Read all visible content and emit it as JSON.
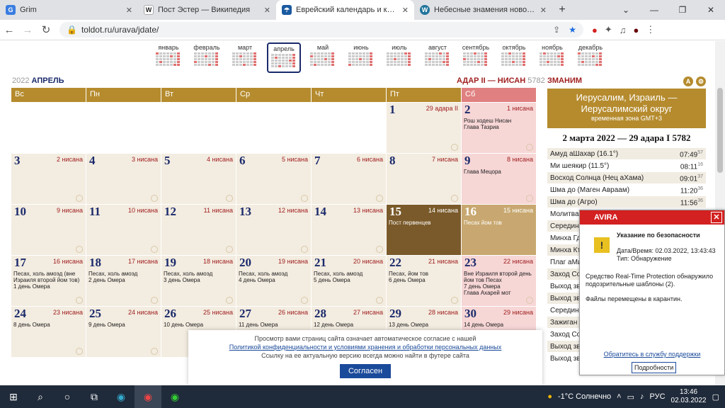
{
  "browser": {
    "tabs": [
      {
        "title": "Grim",
        "icon": "grim-icon",
        "color": "#3b7de0"
      },
      {
        "title": "Пост Эстер — Википедия",
        "icon": "wikipedia-icon",
        "color": "#222222"
      },
      {
        "title": "Еврейский календарь и конвер",
        "icon": "toldot-icon",
        "color": "#1a5aa0",
        "active": true
      },
      {
        "title": "Небесные знамения новой вой",
        "icon": "wordpress-icon",
        "color": "#21759b"
      }
    ],
    "url": "toldot.ru/urava/jdate/"
  },
  "months": [
    {
      "name": "январь"
    },
    {
      "name": "февраль"
    },
    {
      "name": "март"
    },
    {
      "name": "апрель",
      "selected": true
    },
    {
      "name": "май"
    },
    {
      "name": "июнь"
    },
    {
      "name": "июль"
    },
    {
      "name": "август"
    },
    {
      "name": "сентябрь"
    },
    {
      "name": "октябрь"
    },
    {
      "name": "ноябрь"
    },
    {
      "name": "декабрь"
    }
  ],
  "calendar": {
    "year": "2022",
    "month": "АПРЕЛЬ",
    "hebrew_months": "АДАР II — НИСАН",
    "hebrew_year": "5782",
    "weekdays": [
      "Вс",
      "Пн",
      "Вт",
      "Ср",
      "Чт",
      "Пт",
      "Сб"
    ],
    "cells": [
      {
        "g": "",
        "h": "",
        "ev": ""
      },
      {
        "g": "",
        "h": "",
        "ev": ""
      },
      {
        "g": "",
        "h": "",
        "ev": ""
      },
      {
        "g": "",
        "h": "",
        "ev": ""
      },
      {
        "g": "",
        "h": "",
        "ev": ""
      },
      {
        "g": "1",
        "h": "29 адара II",
        "ev": ""
      },
      {
        "g": "2",
        "h": "1 нисана",
        "ev": "Рош ходеш Нисан",
        "ev2": "Глава Тазриа",
        "sat": true
      },
      {
        "g": "3",
        "h": "2 нисана",
        "ev": ""
      },
      {
        "g": "4",
        "h": "3 нисана",
        "ev": ""
      },
      {
        "g": "5",
        "h": "4 нисана",
        "ev": ""
      },
      {
        "g": "6",
        "h": "5 нисана",
        "ev": ""
      },
      {
        "g": "7",
        "h": "6 нисана",
        "ev": ""
      },
      {
        "g": "8",
        "h": "7 нисана",
        "ev": ""
      },
      {
        "g": "9",
        "h": "8 нисана",
        "ev": "Глава Мецора",
        "sat": true
      },
      {
        "g": "10",
        "h": "9 нисана",
        "ev": ""
      },
      {
        "g": "11",
        "h": "10 нисана",
        "ev": ""
      },
      {
        "g": "12",
        "h": "11 нисана",
        "ev": ""
      },
      {
        "g": "13",
        "h": "12 нисана",
        "ev": ""
      },
      {
        "g": "14",
        "h": "13 нисана",
        "ev": ""
      },
      {
        "g": "15",
        "h": "14 нисана",
        "ev": "Пост первенцев",
        "img": true
      },
      {
        "g": "16",
        "h": "15 нисана",
        "ev": "Песах йом тов",
        "img2": true
      },
      {
        "g": "17",
        "h": "16 нисана",
        "ev": "Песах, холь амоэд (вне Израиля второй йом тов)",
        "ev2": "1 день Омера"
      },
      {
        "g": "18",
        "h": "17 нисана",
        "ev": "Песах, холь амоэд",
        "ev2": "2 день Омера"
      },
      {
        "g": "19",
        "h": "18 нисана",
        "ev": "Песах, холь амоэд",
        "ev2": "3 день Омера"
      },
      {
        "g": "20",
        "h": "19 нисана",
        "ev": "Песах, холь амоэд",
        "ev2": "4 день Омера"
      },
      {
        "g": "21",
        "h": "20 нисана",
        "ev": "Песах, холь амоэд",
        "ev2": "5 день Омера"
      },
      {
        "g": "22",
        "h": "21 нисана",
        "ev": "Песах, йом тов",
        "ev2": "6 день Омера"
      },
      {
        "g": "23",
        "h": "22 нисана",
        "ev": "Вне Израиля второй день йом тов Песах",
        "ev2": "7 день Омера",
        "ev3": "Глава Ахарей мот",
        "sat": true
      },
      {
        "g": "24",
        "h": "23 нисана",
        "ev": "8 день Омера"
      },
      {
        "g": "25",
        "h": "24 нисана",
        "ev": "9 день Омера"
      },
      {
        "g": "26",
        "h": "25 нисана",
        "ev": "10 день Омера"
      },
      {
        "g": "27",
        "h": "26 нисана",
        "ev": "11 день Омера"
      },
      {
        "g": "28",
        "h": "27 нисана",
        "ev": "12 день Омера"
      },
      {
        "g": "29",
        "h": "28 нисана",
        "ev": "13 день Омера"
      },
      {
        "g": "30",
        "h": "29 нисана",
        "ev": "14 день Омера",
        "sat": true
      }
    ]
  },
  "sidebar": {
    "title": "ЗМАНИМ",
    "city": "Иерусалим, Израиль — Иерусалимский округ",
    "timezone": "временная зона GMT+3",
    "date": "2 марта 2022 — 29 адара I 5782",
    "zmanim": [
      {
        "name": "Амуд аШахар (16.1°)",
        "time": "07:49",
        "sec": "57"
      },
      {
        "name": "Ми шеякир (11.5°)",
        "time": "08:11",
        "sec": "16"
      },
      {
        "name": "Восход Солнца (Нец аХама)",
        "time": "09:01",
        "sec": "37"
      },
      {
        "name": "Шма до (Маген Авраам)",
        "time": "11:20",
        "sec": "36"
      },
      {
        "name": "Шма до (Агро)",
        "time": "11:56",
        "sec": "36"
      },
      {
        "name": "Молитва",
        "time": "",
        "sec": ""
      },
      {
        "name": "Середина",
        "time": "",
        "sec": ""
      },
      {
        "name": "Минха Гд",
        "time": "",
        "sec": ""
      },
      {
        "name": "Минха Кт",
        "time": "",
        "sec": ""
      },
      {
        "name": "Плаг аМи",
        "time": "",
        "sec": ""
      },
      {
        "name": "Заход Со",
        "time": "",
        "sec": ""
      },
      {
        "name": "Выход зв",
        "time": "",
        "sec": ""
      },
      {
        "name": "Выход зв",
        "time": "",
        "sec": ""
      },
      {
        "name": "Середина",
        "time": "",
        "sec": ""
      }
    ],
    "zmanim_lower": [
      {
        "name": "Зажиган"
      },
      {
        "name": "Заход Со"
      },
      {
        "name": "Выход зв"
      },
      {
        "name": "Выход зв"
      }
    ]
  },
  "cookie": {
    "line1": "Просмотр вами страниц сайта означает автоматическое согласие с нашей",
    "link": "Политикой конфиденциальности и условиями хранения и обработки персональных данных",
    "line2": "Ссылку на ее актуальную версию всегда можно найти в футере сайта",
    "button": "Согласен"
  },
  "avira": {
    "brand": "AVIRA",
    "title": "Указание по безопасности",
    "datetime": "Дата/Время: 02.03.2022, 13:43:43",
    "type": "Тип: Обнаружение",
    "body1": "Средство Real-Time Protection обнаружило подозрительные шаблоны (2).",
    "body2": "Файлы перемещены в карантин.",
    "support": "Обратитесь в службу поддержки",
    "details": "Подробности"
  },
  "taskbar": {
    "weather": "-1°C  Солнечно",
    "lang": "РУС",
    "time": "13:46",
    "date": "02.03.2022"
  }
}
